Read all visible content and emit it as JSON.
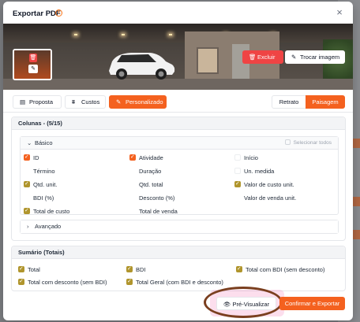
{
  "modal": {
    "title": "Exportar PDF",
    "close": "×"
  },
  "image": {
    "delete_label": "Excluir",
    "replace_label": "Trocar imagem"
  },
  "tabs": [
    {
      "label": "Proposta",
      "icon": "document-icon",
      "active": false
    },
    {
      "label": "Custos",
      "icon": "chart-icon",
      "active": false
    },
    {
      "label": "Personalizado",
      "icon": "pencil-icon",
      "active": true
    }
  ],
  "orientation": {
    "options": [
      "Retrato",
      "Paisagem"
    ],
    "selected": "Paisagem"
  },
  "columns": {
    "title": "Colunas - (5/15)",
    "basic": {
      "label": "Básico",
      "select_all": "Selecionar todos",
      "options": [
        {
          "label": "ID",
          "state": "checked"
        },
        {
          "label": "Atividade",
          "state": "checked"
        },
        {
          "label": "Início",
          "state": "unchecked"
        },
        {
          "label": "Término",
          "state": "unchecked"
        },
        {
          "label": "Duração",
          "state": "unchecked"
        },
        {
          "label": "Un. medida",
          "state": "unchecked"
        },
        {
          "label": "Qtd. unit.",
          "state": "checked"
        },
        {
          "label": "Qtd. total",
          "state": "unchecked"
        },
        {
          "label": "Valor de custo unit.",
          "state": "checked"
        },
        {
          "label": "BDI (%)",
          "state": "unchecked"
        },
        {
          "label": "Desconto (%)",
          "state": "unchecked"
        },
        {
          "label": "Valor de venda unit.",
          "state": "unchecked"
        },
        {
          "label": "Total de custo",
          "state": "checked"
        },
        {
          "label": "Total de venda",
          "state": "unchecked"
        }
      ]
    },
    "advanced": {
      "label": "Avançado"
    }
  },
  "summary": {
    "title": "Sumário (Totais)",
    "options": [
      {
        "label": "Total",
        "state": "checked"
      },
      {
        "label": "BDI",
        "state": "checked"
      },
      {
        "label": "Total com BDI (sem desconto)",
        "state": "checked"
      },
      {
        "label": "Total com desconto (sem BDI)",
        "state": "checked"
      },
      {
        "label": "Total Geral (com BDI e desconto)",
        "state": "checked"
      }
    ]
  },
  "footer": {
    "preview_label": "Pré-Visualizar",
    "confirm_label": "Confirmar e Exportar"
  },
  "colors": {
    "accent": "#f4611f",
    "check_olive": "#b0952d",
    "danger": "#ef4444"
  }
}
